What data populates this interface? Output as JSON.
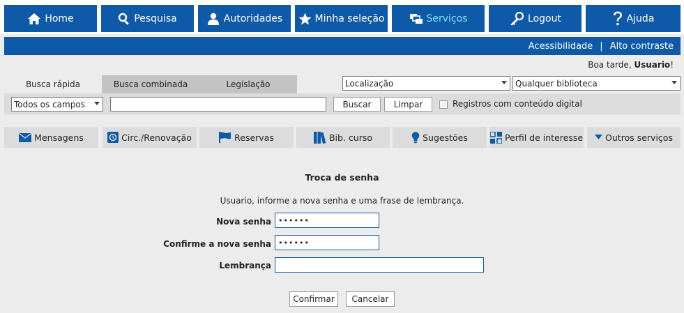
{
  "topnav": {
    "items": [
      {
        "label": "Home",
        "icon": "home-icon"
      },
      {
        "label": "Pesquisa",
        "icon": "search-icon"
      },
      {
        "label": "Autoridades",
        "icon": "user-icon"
      },
      {
        "label": "Minha seleção",
        "icon": "star-icon"
      },
      {
        "label": "Serviços",
        "icon": "windows-icon"
      },
      {
        "label": "Logout",
        "icon": "key-icon"
      },
      {
        "label": "Ajuda",
        "icon": "question-icon"
      }
    ]
  },
  "accessbar": {
    "acessibilidade": "Acessibilidade",
    "separator": "|",
    "alto_contraste": "Alto contraste"
  },
  "greeting": {
    "text": "Boa tarde, ",
    "user": "Usuario",
    "suffix": "!"
  },
  "search": {
    "tabs": [
      "Busca rápida",
      "Busca combinada",
      "Legislação"
    ],
    "localizacao": "Localização",
    "biblioteca": "Qualquer biblioteca",
    "campo": "Todos os campos",
    "query": "",
    "buscar": "Buscar",
    "limpar": "Limpar",
    "digital_label": "Registros com conteúdo digital"
  },
  "services": [
    {
      "label": "Mensagens",
      "icon": "envelope-icon"
    },
    {
      "label": "Circ./Renovação",
      "icon": "clock-icon"
    },
    {
      "label": "Reservas",
      "icon": "flag-icon"
    },
    {
      "label": "Bib. curso",
      "icon": "books-icon"
    },
    {
      "label": "Sugestões",
      "icon": "lightbulb-icon"
    },
    {
      "label": "Perfil de interesse",
      "icon": "grid-icon"
    },
    {
      "label": "Outros serviços",
      "icon": "caret-down-icon"
    }
  ],
  "form": {
    "title": "Troca de senha",
    "instruction": "Usuario, informe a nova senha e uma frase de lembrança.",
    "nova_senha_label": "Nova senha",
    "nova_senha_value": "••••••",
    "confirme_label": "Confirme a nova senha",
    "confirme_value": "••••••",
    "lembranca_label": "Lembrança",
    "lembranca_value": "",
    "confirmar": "Confirmar",
    "cancelar": "Cancelar"
  },
  "colors": {
    "primary": "#0e5aa8",
    "active_text": "#7fe0ff",
    "background": "#ececec"
  }
}
